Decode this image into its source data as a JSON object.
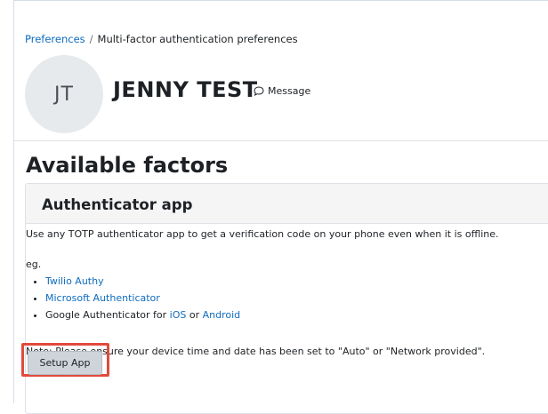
{
  "breadcrumb": {
    "items": [
      "Preferences",
      "Multi-factor authentication preferences"
    ],
    "separator": "/"
  },
  "profile": {
    "initials": "JT",
    "name": "JENNY TEST",
    "message_label": "Message"
  },
  "page": {
    "section_title": "Available factors"
  },
  "factor": {
    "title": "Authenticator app",
    "description": "Use any TOTP authenticator app to get a verification code on your phone even when it is offline.",
    "eg_label": "eg.",
    "apps": [
      {
        "label": "Twilio Authy"
      },
      {
        "label": "Microsoft Authenticator"
      }
    ],
    "google": {
      "prefix": "Google Authenticator for ",
      "ios": "iOS",
      "or": " or ",
      "android": "Android"
    },
    "note": "Note: Please ensure your device time and date has been set to \"Auto\" or \"Network provided\".",
    "button_label": "Setup App"
  },
  "colors": {
    "link": "#0f6cbf",
    "highlight": "#e24a3b",
    "button": "#ced4da",
    "text": "#1d2125"
  }
}
